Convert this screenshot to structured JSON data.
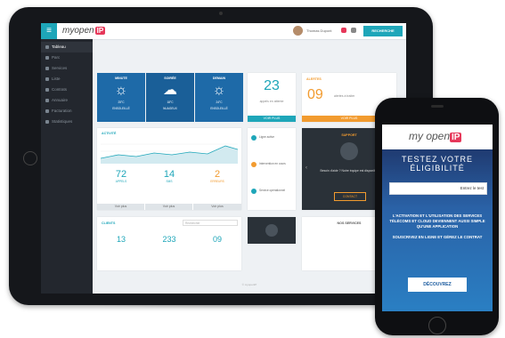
{
  "topbar": {
    "logo_prefix": "my",
    "logo_main": "open",
    "logo_badge": "IP",
    "user_name": "Thomas Dupont",
    "button_label": "RECHERCHE"
  },
  "sidebar": {
    "items": [
      {
        "label": "Tableau"
      },
      {
        "label": "Parc"
      },
      {
        "label": "Services"
      },
      {
        "label": "Liste"
      },
      {
        "label": "Contrats"
      },
      {
        "label": "Annuaire"
      },
      {
        "label": "Facturation"
      },
      {
        "label": "Statistiques"
      }
    ]
  },
  "weather": [
    {
      "title": "MINUTE",
      "icon": "sun-icon",
      "line1": "25°C",
      "line2": "ENSOLEILLÉ"
    },
    {
      "title": "SOIRÉE",
      "icon": "cloud-sun-icon",
      "line1": "18°C",
      "line2": "NUAGEUX"
    },
    {
      "title": "DEMAIN",
      "icon": "sun-icon",
      "line1": "24°C",
      "line2": "ENSOLEILLÉ"
    }
  ],
  "kpis": {
    "big_number": "23",
    "big_caption": "appels en attente",
    "big_button": "VOIR PLUS",
    "orange_title": "ALERTES",
    "orange_number": "09",
    "orange_caption": "alertes à traiter",
    "orange_button": "VOIR PLUS"
  },
  "activity": {
    "title": "ACTIVITÉ",
    "stats": [
      {
        "value": "72",
        "label": "APPELS",
        "color": "#1ea6b9"
      },
      {
        "value": "14",
        "label": "SMS",
        "color": "#1ea6b9"
      },
      {
        "value": "2",
        "label": "ERREURS",
        "color": "#f29b2f"
      }
    ],
    "footer_buttons": [
      "Voir plus",
      "Voir plus",
      "Voir plus"
    ],
    "side_items": [
      {
        "icon": "phone-icon",
        "color": "#1ea6b9",
        "text": "Ligne active"
      },
      {
        "icon": "alert-icon",
        "color": "#f29b2f",
        "text": "Intervention en cours"
      },
      {
        "icon": "check-icon",
        "color": "#1ea6b9",
        "text": "Service opérationnel"
      }
    ]
  },
  "support": {
    "title": "SUPPORT",
    "text": "Besoin d'aide ? Notre équipe est disponible",
    "button": "CONTACT"
  },
  "clients": {
    "title": "CLIENTS",
    "search_placeholder": "Rechercher",
    "values": [
      "13",
      "233",
      "09"
    ]
  },
  "bottom_right_title": "NOS SERVICES",
  "footer_text": "© myopenIP",
  "phone": {
    "logo_main": "my open",
    "logo_badge": "IP",
    "heading": "TESTEZ VOTRE ÉLIGIBILITÉ",
    "input_placeholder": "Entrez le test",
    "body_text": "L'ACTIVATION ET L'UTILISATION DES SERVICES TÉLÉCOMS ET CLOUD DEVIENNENT AUSSI SIMPLE QU'UNE APPLICATION",
    "body_text2": "SOUSCRIVEZ EN LIGNE ET GÉREZ LE CONTRAT",
    "button": "DÉCOUVREZ"
  }
}
